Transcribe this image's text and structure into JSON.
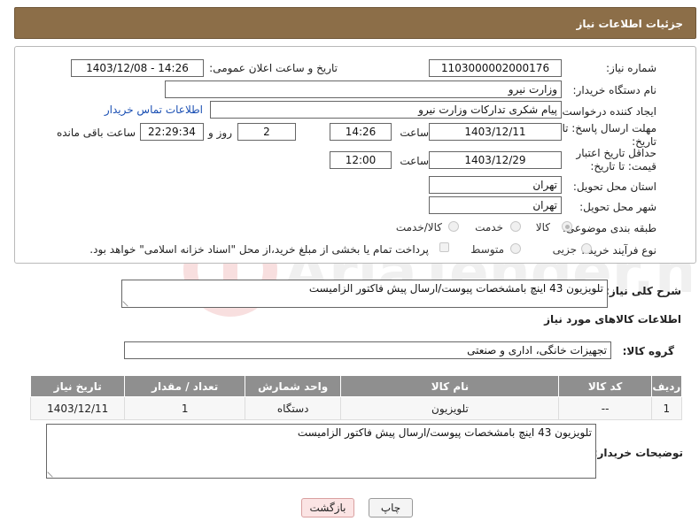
{
  "header": {
    "title": "جزئیات اطلاعات نیاز"
  },
  "form": {
    "need_number_label": "شماره نیاز:",
    "need_number": "1103000002000176",
    "announce_label": "تاریخ و ساعت اعلان عمومی:",
    "announce_value": "1403/12/08 - 14:26",
    "buyer_label": "نام دستگاه خریدار:",
    "buyer_value": "وزارت نیرو",
    "creator_label": "ایجاد کننده درخواست:",
    "creator_value": "پیام شکری تدارکات وزارت نیرو",
    "contact_link": "اطلاعات تماس خریدار",
    "deadline_label": "مهلت ارسال پاسخ: تا تاریخ:",
    "deadline_date": "1403/12/11",
    "time_word": "ساعت",
    "deadline_time": "14:26",
    "days_value": "2",
    "days_word": "روز و",
    "remaining_time": "22:29:34",
    "remaining_word": "ساعت باقی مانده",
    "validity_label": "حداقل تاریخ اعتبار قیمت: تا تاریخ:",
    "validity_date": "1403/12/29",
    "validity_time": "12:00",
    "province_label": "استان محل تحویل:",
    "province_value": "تهران",
    "city_label": "شهر محل تحویل:",
    "city_value": "تهران",
    "category_label": "طبقه بندی موضوعی:",
    "category_options": [
      "کالا",
      "خدمت",
      "کالا/خدمت"
    ],
    "process_label": "نوع فرآیند خرید :",
    "process_options": [
      "جزیی",
      "متوسط"
    ],
    "payment_note": "پرداخت تمام یا بخشی از مبلغ خرید،از محل \"اسناد خزانه اسلامی\" خواهد بود."
  },
  "summary": {
    "desc_label": "شرح کلی نیاز:",
    "desc_value": "تلویزیون 43 اینچ بامشخصات پیوست/ارسال پیش فاکتور الزامیست",
    "goods_info_title": "اطلاعات کالاهای مورد نیاز",
    "group_label": "گروه کالا:",
    "group_value": "تجهیزات خانگی، اداری و صنعتی"
  },
  "table": {
    "headers": [
      "ردیف",
      "کد کالا",
      "نام کالا",
      "واحد شمارش",
      "تعداد / مقدار",
      "تاریخ نیاز"
    ],
    "rows": [
      [
        "1",
        "--",
        "تلویزیون",
        "دستگاه",
        "1",
        "1403/12/11"
      ]
    ]
  },
  "buyer_notes": {
    "label": "توضیحات خریدار:",
    "value": "تلویزیون 43 اینچ بامشخصات پیوست/ارسال پیش فاکتور الزامیست"
  },
  "buttons": {
    "print": "چاپ",
    "back": "بازگشت"
  },
  "watermark": {
    "text": "AriaTender.net"
  }
}
